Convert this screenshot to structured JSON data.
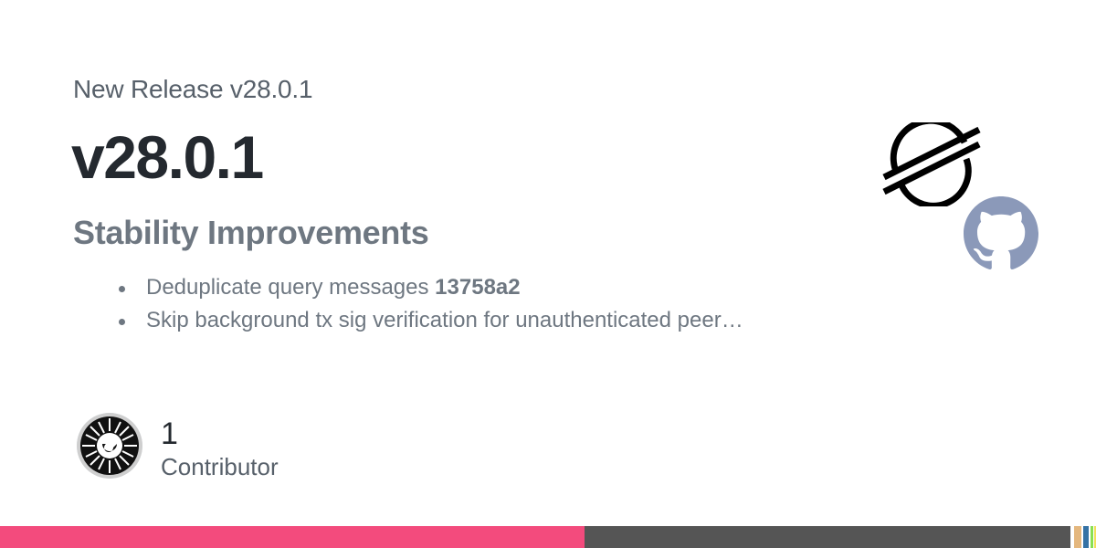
{
  "header": {
    "eyebrow": "New Release v28.0.1",
    "title": "v28.0.1",
    "subtitle": "Stability Improvements"
  },
  "notes": [
    {
      "text": "Deduplicate query messages ",
      "commit": "13758a2"
    },
    {
      "text": "Skip background tx sig verification for unauthenticated peer…",
      "commit": ""
    }
  ],
  "logos": {
    "stellar": "stellar-logo",
    "github": "github-octocat-icon"
  },
  "contributors": {
    "count": "1",
    "label": "Contributor"
  },
  "language_bar": [
    {
      "color": "#f34b7d",
      "share": 0.5333
    },
    {
      "color": "#555555",
      "share": 0.4433
    },
    {
      "color": "#ffffff",
      "share": 0.0034
    },
    {
      "color": "#e4b77e",
      "share": 0.0067
    },
    {
      "color": "#ffffff",
      "share": 0.0017
    },
    {
      "color": "#3572a5",
      "share": 0.005
    },
    {
      "color": "#ffffff",
      "share": 0.0017
    },
    {
      "color": "#89e051",
      "share": 0.0025
    },
    {
      "color": "#ffffff",
      "share": 0.0008
    },
    {
      "color": "#f1e05a",
      "share": 0.0016
    }
  ]
}
